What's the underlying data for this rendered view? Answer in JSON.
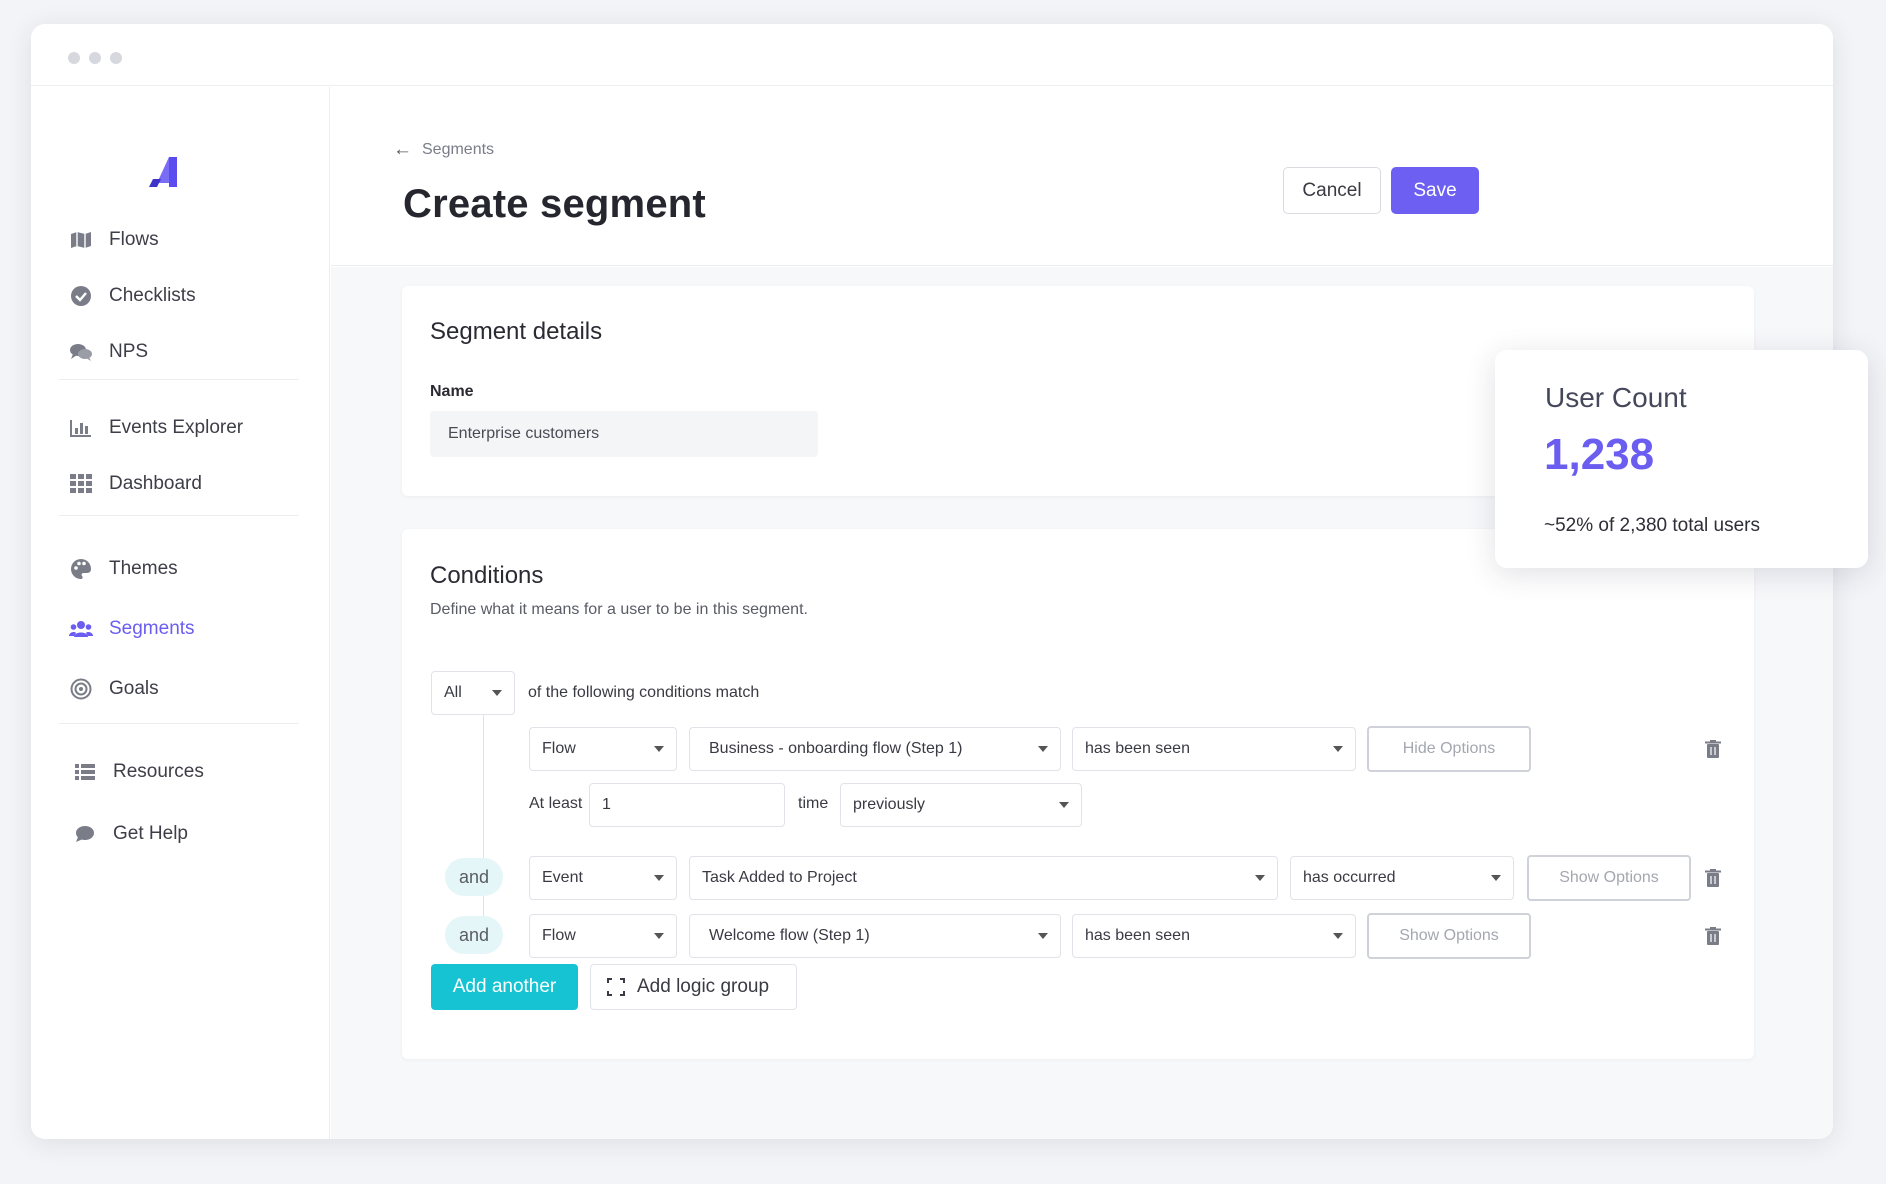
{
  "window": {
    "controls": [
      "close",
      "minimize",
      "maximize"
    ]
  },
  "sidebar": {
    "logo_icon": "appcues-logo-icon",
    "groups": [
      [
        {
          "label": "Flows",
          "icon": "map-icon"
        },
        {
          "label": "Checklists",
          "icon": "check-circle-icon"
        },
        {
          "label": "NPS",
          "icon": "chat-bubbles-icon"
        }
      ],
      [
        {
          "label": "Events Explorer",
          "icon": "bar-chart-icon"
        },
        {
          "label": "Dashboard",
          "icon": "grid-icon"
        }
      ],
      [
        {
          "label": "Themes",
          "icon": "palette-icon"
        },
        {
          "label": "Segments",
          "icon": "users-icon",
          "active": true
        },
        {
          "label": "Goals",
          "icon": "target-icon"
        }
      ],
      [
        {
          "label": "Resources",
          "icon": "list-icon"
        },
        {
          "label": "Get Help",
          "icon": "chat-icon"
        }
      ]
    ]
  },
  "header": {
    "breadcrumb": "Segments",
    "title": "Create segment",
    "cancel_label": "Cancel",
    "save_label": "Save"
  },
  "details": {
    "title": "Segment details",
    "name_label": "Name",
    "name_value": "Enterprise customers"
  },
  "conditions": {
    "title": "Conditions",
    "description": "Define what it means for a user to be in this segment.",
    "match_mode": "All",
    "match_text": "of the following conditions match",
    "rows": [
      {
        "connector": "",
        "type": "Flow",
        "target": "Business - onboarding flow (Step 1)",
        "operator": "has been seen",
        "options_label": "Hide Options",
        "at_least_label": "At least",
        "count": "1",
        "time_label": "time",
        "timeframe": "previously"
      },
      {
        "connector": "and",
        "type": "Event",
        "target": "Task Added to Project",
        "operator": "has occurred",
        "options_label": "Show Options"
      },
      {
        "connector": "and",
        "type": "Flow",
        "target": "Welcome flow (Step 1)",
        "operator": "has been seen",
        "options_label": "Show Options"
      }
    ],
    "add_another_label": "Add another",
    "add_group_label": "Add logic group"
  },
  "user_count": {
    "title": "User Count",
    "count": "1,238",
    "subtitle": "~52% of 2,380 total users"
  },
  "colors": {
    "accent": "#6c5ff2",
    "teal": "#16c3d3"
  }
}
